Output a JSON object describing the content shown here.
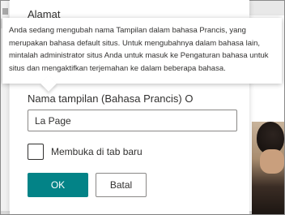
{
  "section": {
    "title": "Alamat"
  },
  "tooltip": {
    "text": "Anda sedang mengubah nama Tampilan dalam bahasa Prancis, yang merupakan bahasa default situs. Untuk mengubahnya dalam bahasa lain, mintalah administrator situs Anda untuk masuk ke Pengaturan bahasa untuk situs dan mengaktifkan terjemahan ke dalam beberapa bahasa."
  },
  "form": {
    "display_name_label": "Nama tampilan (Bahasa Prancis) O",
    "display_name_value": "La Page",
    "new_tab_label": "Membuka di tab baru",
    "ok_label": "OK",
    "cancel_label": "Batal"
  },
  "colors": {
    "accent": "#038387"
  }
}
